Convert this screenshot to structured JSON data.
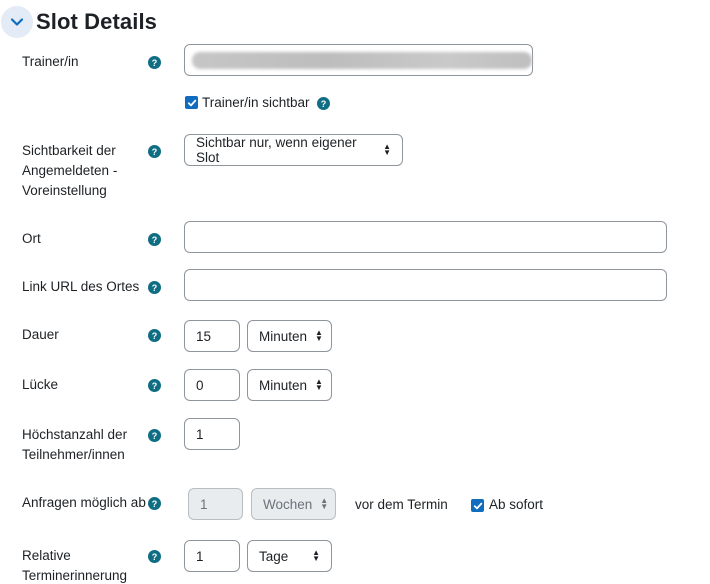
{
  "section": {
    "title": "Slot Details"
  },
  "trainer": {
    "label": "Trainer/in",
    "visible_label": "Trainer/in sichtbar",
    "visible_checked": true
  },
  "visibility": {
    "label_lines": [
      "Sichtbarkeit der",
      "Angemeldeten -",
      "Voreinstellung"
    ],
    "selected": "Sichtbar nur, wenn eigener Slot"
  },
  "location": {
    "label": "Ort",
    "value": ""
  },
  "location_url": {
    "label": "Link URL des Ortes",
    "value": ""
  },
  "duration": {
    "label": "Dauer",
    "value": "15",
    "unit": "Minuten"
  },
  "gap": {
    "label": "Lücke",
    "value": "0",
    "unit": "Minuten"
  },
  "max_participants": {
    "label_lines": [
      "Höchstanzahl der",
      "Teilnehmer/innen"
    ],
    "value": "1"
  },
  "requests_from": {
    "label": "Anfragen möglich ab",
    "value": "1",
    "unit": "Wochen",
    "suffix": "vor dem Termin",
    "immediately_label": "Ab sofort",
    "immediately_checked": true
  },
  "reminder": {
    "label_lines": [
      "Relative",
      "Terminerinnerung"
    ],
    "value": "1",
    "unit": "Tage"
  },
  "icons": {
    "help": "?"
  }
}
